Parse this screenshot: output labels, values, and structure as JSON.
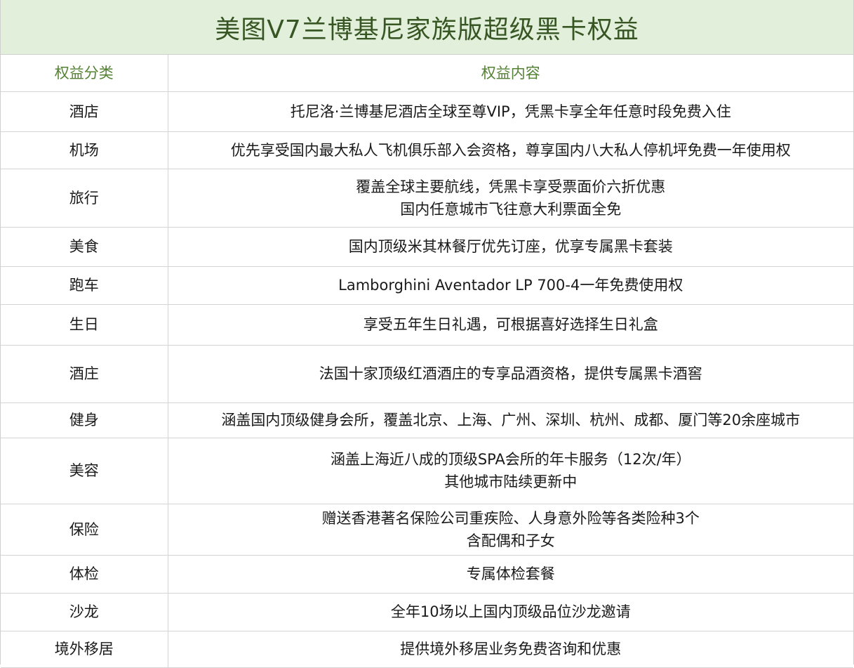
{
  "title": "美图V7兰博基尼家族版超级黑卡权益",
  "table": {
    "headers": [
      "权益分类",
      "权益内容"
    ],
    "rows": [
      {
        "category": "酒店",
        "lines": [
          "托尼洛·兰博基尼酒店全球至尊VIP，凭黑卡享全年任意时段免费入住"
        ]
      },
      {
        "category": "机场",
        "lines": [
          "优先享受国内最大私人飞机俱乐部入会资格，尊享国内八大私人停机坪免费一年使用权"
        ]
      },
      {
        "category": "旅行",
        "lines": [
          "覆盖全球主要航线，凭黑卡享受票面价六折优惠",
          "国内任意城市飞往意大利票面全免"
        ]
      },
      {
        "category": "美食",
        "lines": [
          "国内顶级米其林餐厅优先订座，优享专属黑卡套装"
        ]
      },
      {
        "category": "跑车",
        "lines": [
          "Lamborghini Aventador LP 700-4一年免费使用权"
        ]
      },
      {
        "category": "生日",
        "lines": [
          "享受五年生日礼遇，可根据喜好选择生日礼盒"
        ]
      },
      {
        "category": "酒庄",
        "lines": [
          "法国十家顶级红酒酒庄的专享品酒资格，提供专属黑卡酒窖"
        ]
      },
      {
        "category": "健身",
        "lines": [
          "涵盖国内顶级健身会所，覆盖北京、上海、广州、深圳、杭州、成都、厦门等20余座城市"
        ]
      },
      {
        "category": "美容",
        "lines": [
          "涵盖上海近八成的顶级SPA会所的年卡服务（12次/年）",
          "其他城市陆续更新中"
        ]
      },
      {
        "category": "保险",
        "lines": [
          "赠送香港著名保险公司重疾险、人身意外险等各类险种3个",
          "含配偶和子女"
        ]
      },
      {
        "category": "体检",
        "lines": [
          "专属体检套餐"
        ]
      },
      {
        "category": "沙龙",
        "lines": [
          "全年10场以上国内顶级品位沙龙邀请"
        ]
      },
      {
        "category": "境外移居",
        "lines": [
          "提供境外移居业务免费咨询和优惠"
        ]
      }
    ]
  },
  "colors": {
    "title_background": "#e2efda",
    "title_text": "#375623",
    "header_text": "#548235",
    "grid": "#d4d4d4"
  }
}
